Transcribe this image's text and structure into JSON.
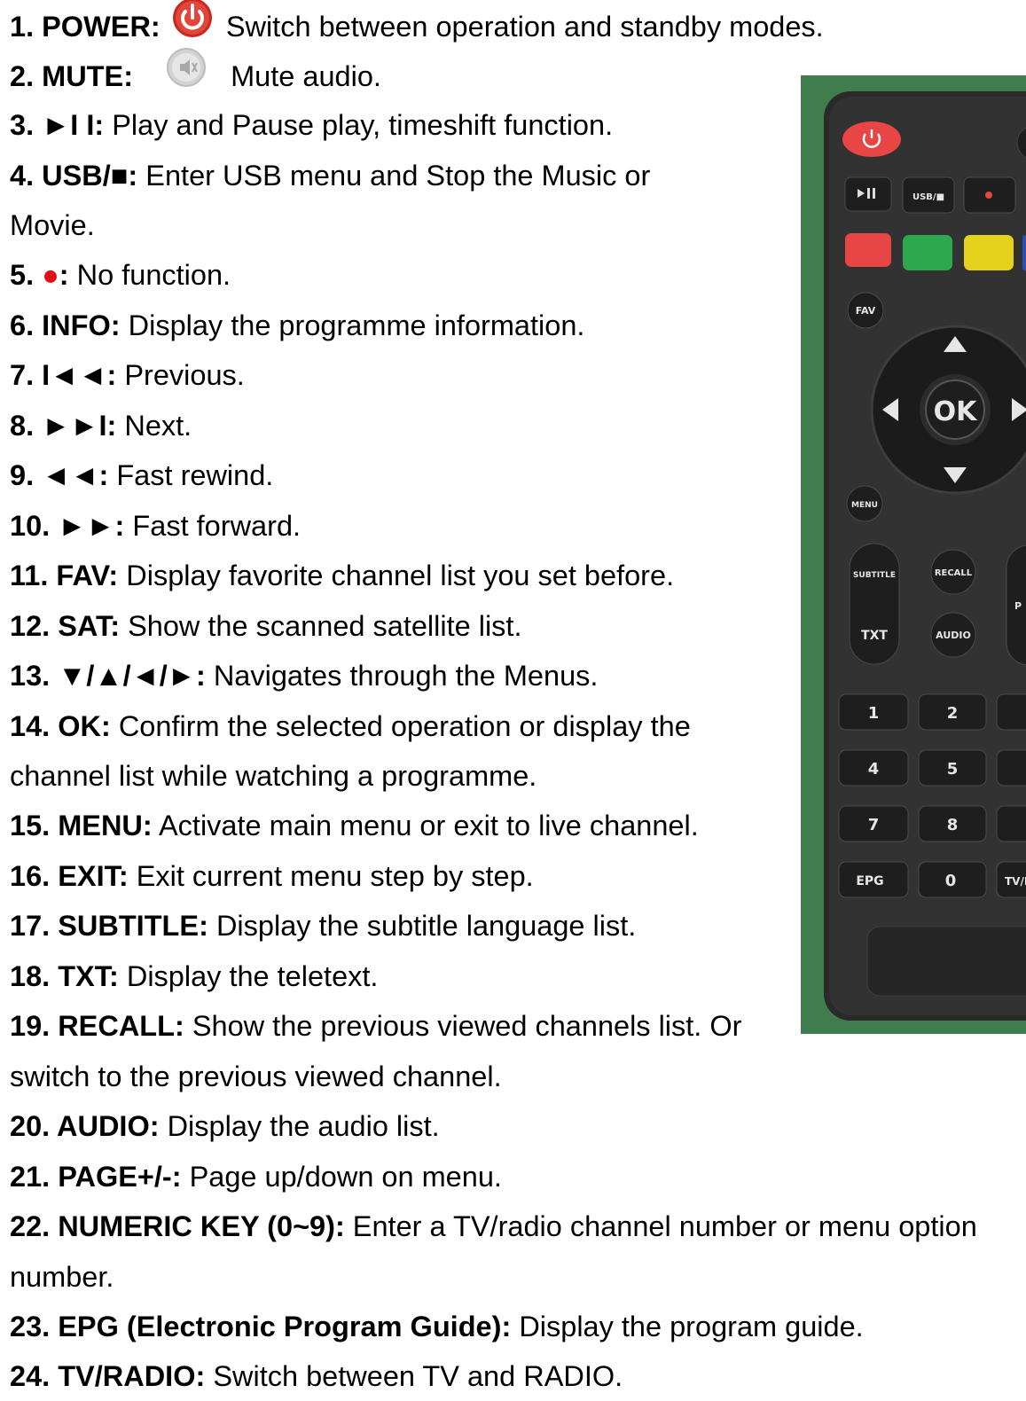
{
  "items": [
    {
      "label": "1. POWER:",
      "icon": "power-icon",
      "desc": "Switch between operation and standby modes."
    },
    {
      "label": "2. MUTE:",
      "icon": "mute-icon",
      "desc": "Mute audio."
    },
    {
      "label": "3. ►I I:",
      "desc": "Play and Pause play, timeshift function."
    },
    {
      "label": "4. USB/■:",
      "desc": "Enter USB menu and Stop the Music or",
      "desc_cont": "Movie."
    },
    {
      "label_prefix": "5. ",
      "label_symbol": "●",
      "label_suffix": ":",
      "desc": "No function."
    },
    {
      "label": "6. INFO:",
      "desc": "Display the programme information."
    },
    {
      "label": "7. I◄◄:",
      "desc": "Previous."
    },
    {
      "label": "8. ►►I:",
      "desc": "Next."
    },
    {
      "label": "9. ◄◄:",
      "desc": "Fast rewind."
    },
    {
      "label": "10. ►►:",
      "desc": "Fast forward."
    },
    {
      "label": "11. FAV:",
      "desc": "Display favorite channel list you set before."
    },
    {
      "label": "12. SAT:",
      "desc": "Show the scanned satellite list."
    },
    {
      "label": "13. ▼/▲/◄/►:",
      "desc": "Navigates through the Menus."
    },
    {
      "label": "14. OK:",
      "desc": "Confirm the selected operation or display the",
      "desc_cont": "channel list while watching a programme."
    },
    {
      "label": "15. MENU:",
      "desc": "Activate main menu or exit to live channel."
    },
    {
      "label": "16. EXIT:",
      "desc": "Exit current menu step by step."
    },
    {
      "label": "17. SUBTITLE:",
      "desc": "Display the subtitle language list."
    },
    {
      "label": "18. TXT:",
      "desc": "Display the teletext."
    },
    {
      "label": "19. RECALL:",
      "desc": "Show the previous viewed channels list. Or",
      "desc_cont": "switch to the previous viewed channel."
    },
    {
      "label": "20. AUDIO:",
      "desc": "Display the audio list."
    },
    {
      "label": "21. PAGE+/-:",
      "desc": "Page up/down on menu."
    },
    {
      "label": "22. NUMERIC KEY (0~9):",
      "desc": "Enter a TV/radio channel number or menu option",
      "desc_cont": "number."
    },
    {
      "label": "23. EPG (Electronic Program Guide):",
      "desc": "Display the program guide."
    },
    {
      "label": "24. TV/RADIO:",
      "desc": "Switch between TV and RADIO."
    }
  ],
  "remote": {
    "keys": {
      "usb": "USB/■",
      "fav": "FAV",
      "ok": "OK",
      "menu": "MENU",
      "subtitle": "SUBTITLE",
      "recall": "RECALL",
      "txt": "TXT",
      "audio": "AUDIO",
      "n1": "1",
      "n2": "2",
      "n4": "4",
      "n5": "5",
      "n7": "7",
      "n8": "8",
      "epg": "EPG",
      "n0": "0",
      "tvr": "TV/R",
      "p": "P"
    },
    "colors": {
      "background": "#3f7d4c",
      "body": "#2a2a2a",
      "red": "#e84545",
      "green": "#2ea84e",
      "yellow": "#e6d21c"
    }
  }
}
